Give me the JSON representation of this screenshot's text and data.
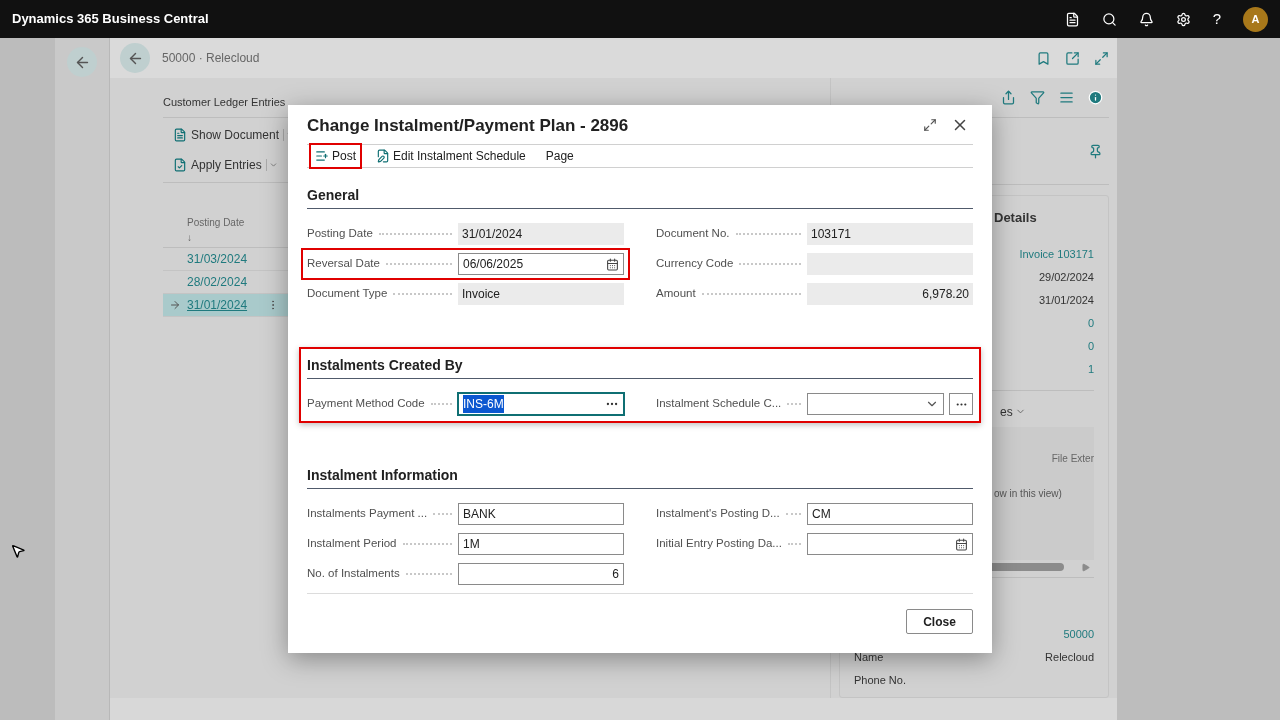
{
  "top_bar": {
    "title": "Dynamics 365 Business Central",
    "help": "?",
    "avatar": "A"
  },
  "page": {
    "title": "50000 · Relecloud",
    "list_title": "Customer Ledger Entries",
    "actions": [
      {
        "label": "Show Document",
        "kind": "document"
      },
      {
        "label": "Apply Entries",
        "kind": "apply"
      }
    ],
    "column": {
      "label": "Posting Date",
      "sort": "↓"
    },
    "rows": [
      {
        "posting_date": "31/03/2024",
        "selected": false
      },
      {
        "posting_date": "28/02/2024",
        "selected": false
      },
      {
        "posting_date": "31/01/2024",
        "selected": true
      }
    ],
    "factbox": {
      "details_title": "Details",
      "details_values": [
        {
          "text": "Invoice 103171",
          "kind": "link"
        },
        {
          "text": "29/02/2024",
          "kind": "text"
        },
        {
          "text": "31/01/2024",
          "kind": "text"
        },
        {
          "text": "0",
          "kind": "link"
        },
        {
          "text": "0",
          "kind": "link"
        },
        {
          "text": "1",
          "kind": "link"
        }
      ],
      "attachments_title": "es",
      "attachments_column": "File Exter",
      "attachments_empty": "ow in this view)",
      "customer_fields": [
        {
          "value": "50000",
          "kind": "link"
        },
        {
          "label": "Name",
          "value": "Relecloud",
          "kind": "text"
        },
        {
          "label": "Phone No."
        }
      ]
    }
  },
  "dialog": {
    "title": "Change Instalment/Payment Plan - 2896",
    "actions": [
      {
        "label": "Post",
        "kind": "post",
        "highlighted": true
      },
      {
        "label": "Edit Instalment Schedule",
        "kind": "edit",
        "highlighted": false
      },
      {
        "label": "Page",
        "kind": "plain",
        "highlighted": false
      }
    ],
    "sections": [
      {
        "title": "General",
        "highlighted": false,
        "columns": [
          [
            {
              "label": "Posting Date",
              "value": "31/01/2024",
              "kind": "readonly",
              "highlighted": false,
              "focused": false
            },
            {
              "label": "Reversal Date",
              "value": "06/06/2025",
              "kind": "date",
              "highlighted": true,
              "focused": false
            },
            {
              "label": "Document Type",
              "value": "Invoice",
              "kind": "readonly",
              "highlighted": false,
              "focused": false
            }
          ],
          [
            {
              "label": "Document No.",
              "value": "103171",
              "kind": "readonly",
              "highlighted": false,
              "focused": false
            },
            {
              "label": "Currency Code",
              "kind": "readonly",
              "highlighted": false,
              "focused": false
            },
            {
              "label": "Amount",
              "value": "6,978.20",
              "kind": "amount",
              "highlighted": false,
              "focused": false
            }
          ]
        ]
      },
      {
        "title": "Instalments Created By",
        "highlighted": true,
        "columns": [
          [
            {
              "label": "Payment Method Code",
              "value": "INS-6M",
              "kind": "lookup",
              "highlighted": false,
              "focused": true
            }
          ],
          [
            {
              "label": "Instalment Schedule C...",
              "kind": "select",
              "highlighted": false,
              "focused": false
            }
          ]
        ]
      },
      {
        "title": "Instalment Information",
        "highlighted": false,
        "columns": [
          [
            {
              "label": "Instalments Payment ...",
              "value": "BANK",
              "kind": "text",
              "highlighted": false,
              "focused": false
            },
            {
              "label": "Instalment Period",
              "value": "1M",
              "kind": "text",
              "highlighted": false,
              "focused": false
            },
            {
              "label": "No. of Instalments",
              "value": "6",
              "kind": "number",
              "highlighted": false,
              "focused": false
            }
          ],
          [
            {
              "label": "Instalment's Posting D...",
              "value": "CM",
              "kind": "text",
              "highlighted": false,
              "focused": false
            },
            {
              "label": "Initial Entry Posting Da...",
              "kind": "date",
              "highlighted": false,
              "focused": false
            }
          ]
        ]
      }
    ],
    "close_button": "Close"
  }
}
